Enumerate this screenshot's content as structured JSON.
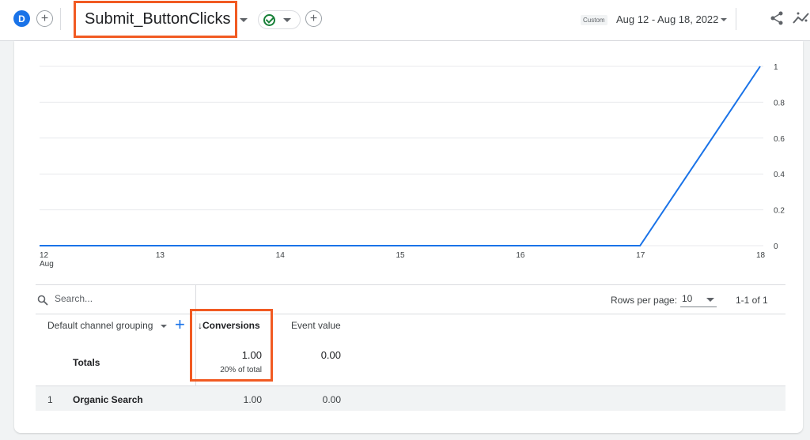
{
  "header": {
    "avatar_letter": "D",
    "add_comparison_icon": "plus-icon",
    "report_title": "Submit_ButtonClicks",
    "status_icon": "check-circle-icon",
    "add_filter_icon": "plus-icon",
    "date_label": "Custom",
    "date_range": "Aug 12 - Aug 18, 2022",
    "share_icon": "share-icon",
    "insights_icon": "insights-icon"
  },
  "chart_data": {
    "type": "line",
    "x": [
      "12",
      "13",
      "14",
      "15",
      "16",
      "17",
      "18"
    ],
    "x_sublabel": "Aug",
    "series": [
      {
        "values": [
          0,
          0,
          0,
          0,
          0,
          0,
          1
        ],
        "color": "#1a73e8"
      }
    ],
    "y_ticks": [
      "0",
      "0.2",
      "0.4",
      "0.6",
      "0.8",
      "1"
    ],
    "ylim": [
      0,
      1
    ],
    "grid": true
  },
  "table": {
    "search_placeholder": "Search...",
    "rows_per_page_label": "Rows per page:",
    "rows_per_page_value": "10",
    "page_info": "1-1 of 1",
    "columns": {
      "dimension": "Default channel grouping",
      "conversions": "↓Conversions",
      "event_value": "Event value"
    },
    "totals": {
      "label": "Totals",
      "conversions": "1.00",
      "conversions_pct": "20% of total",
      "event_value": "0.00"
    },
    "rows": [
      {
        "index": "1",
        "name": "Organic Search",
        "conversions": "1.00",
        "event_value": "0.00"
      }
    ]
  },
  "colors": {
    "accent": "#1a73e8",
    "highlight": "#f15a22"
  }
}
